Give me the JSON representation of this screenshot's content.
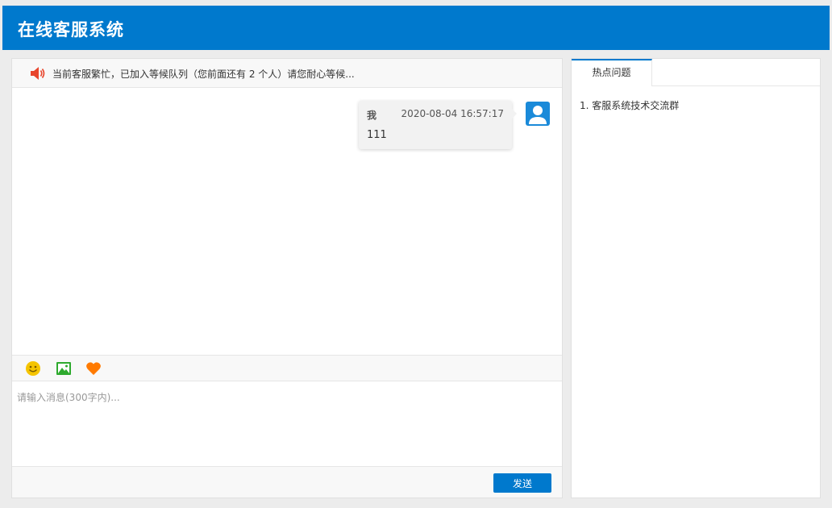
{
  "header": {
    "title": "在线客服系统"
  },
  "notice": {
    "icon": "speaker-icon",
    "text": "当前客服繁忙，已加入等候队列（您前面还有 2 个人）请您耐心等候..."
  },
  "messages": [
    {
      "sender": "我",
      "time": "2020-08-04 16:57:17",
      "text": "111",
      "avatar_icon": "user-avatar-icon"
    }
  ],
  "toolbar": {
    "tools": [
      {
        "name": "emoji",
        "icon": "smiley-icon",
        "color": "#f5c400"
      },
      {
        "name": "image",
        "icon": "image-icon",
        "color": "#2eaa2e"
      },
      {
        "name": "favorite",
        "icon": "heart-icon",
        "color": "#ff7a00"
      }
    ]
  },
  "input": {
    "placeholder": "请输入消息(300字内)...",
    "value": ""
  },
  "send": {
    "label": "发送"
  },
  "sidebar": {
    "tabs": [
      {
        "label": "热点问题",
        "active": true
      }
    ],
    "faq": [
      "1. 客服系统技术交流群"
    ]
  },
  "colors": {
    "primary": "#0079cd",
    "accent_orange": "#ff7a00",
    "notice_red": "#e8452c"
  }
}
